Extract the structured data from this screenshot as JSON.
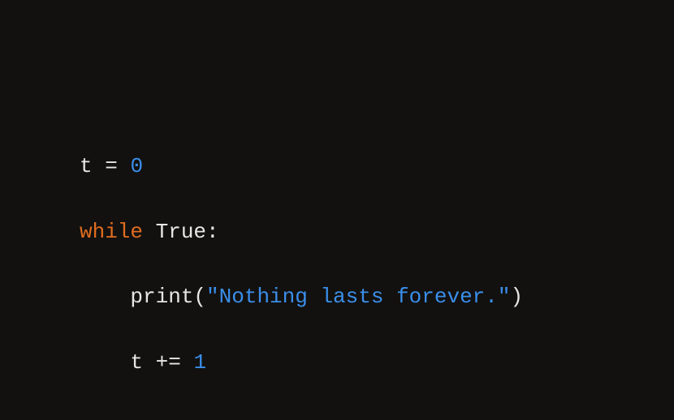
{
  "code": {
    "line1": {
      "var": "t",
      "op": "=",
      "num": "0"
    },
    "line2": {
      "keyword": "while",
      "constant": "True",
      "colon": ":"
    },
    "line3": {
      "func": "print",
      "lparen": "(",
      "string": "\"Nothing lasts forever.\"",
      "rparen": ")"
    },
    "line4": {
      "var": "t",
      "op": "+=",
      "num": "1"
    }
  }
}
